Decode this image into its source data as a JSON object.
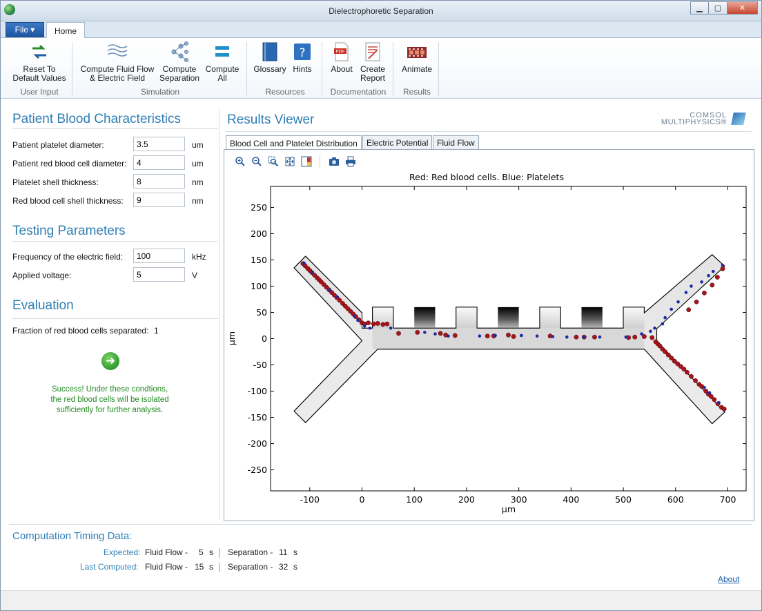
{
  "window": {
    "title": "Dielectrophoretic Separation",
    "controls": {
      "minimize": "▁",
      "maximize": "▢",
      "close": "✕"
    }
  },
  "ribbon": {
    "tabs": {
      "file": "File ▾",
      "home": "Home"
    },
    "buttons": {
      "reset": [
        "Reset To",
        "Default Values"
      ],
      "compute_flow": [
        "Compute Fluid Flow",
        "& Electric Field"
      ],
      "compute_separation": [
        "Compute",
        "Separation"
      ],
      "compute_all": [
        "Compute",
        "All"
      ],
      "glossary": "Glossary",
      "hints": "Hints",
      "about": "About",
      "create_report": [
        "Create",
        "Report"
      ],
      "animate": "Animate"
    },
    "groups": {
      "user_input": "User Input",
      "simulation": "Simulation",
      "resources": "Resources",
      "documentation": "Documentation",
      "results": "Results"
    }
  },
  "patient": {
    "title": "Patient Blood Characteristics",
    "fields": [
      {
        "label": "Patient platelet diameter:",
        "value": "3.5",
        "unit": "um"
      },
      {
        "label": "Patient red blood cell diameter:",
        "value": "4",
        "unit": "um"
      },
      {
        "label": "Platelet shell thickness:",
        "value": "8",
        "unit": "nm"
      },
      {
        "label": "Red blood cell shell thickness:",
        "value": "9",
        "unit": "nm"
      }
    ]
  },
  "testing": {
    "title": "Testing Parameters",
    "fields": [
      {
        "label": "Frequency of the electric field:",
        "value": "100",
        "unit": "kHz"
      },
      {
        "label": "Applied voltage:",
        "value": "5",
        "unit": "V"
      }
    ]
  },
  "evaluation": {
    "title": "Evaluation",
    "fraction_label": "Fraction of red blood cells separated:",
    "fraction_value": "1",
    "success_lines": [
      "Success! Under these condtions,",
      "the red blood cells will be isolated",
      "sufficiently for further analysis."
    ]
  },
  "results": {
    "title": "Results Viewer",
    "logo": {
      "line1": "COMSOL",
      "line2": "MULTIPHYSICS®"
    },
    "tabs": [
      "Blood Cell and Platelet Distribution",
      "Electric Potential",
      "Fluid Flow"
    ],
    "toolbar_icons": [
      "zoom-in-icon",
      "zoom-out-icon",
      "zoom-box-icon",
      "zoom-extents-icon",
      "color-table-icon",
      "camera-icon",
      "print-icon"
    ]
  },
  "chart_data": {
    "type": "scatter",
    "title": "Red: Red blood cells. Blue: Platelets",
    "xlabel": "µm",
    "ylabel": "µm",
    "xlim": [
      -175,
      735
    ],
    "ylim": [
      -290,
      290
    ],
    "xticks": [
      -100,
      0,
      100,
      200,
      300,
      400,
      500,
      600,
      700
    ],
    "yticks": [
      -250,
      -200,
      -150,
      -100,
      -50,
      0,
      50,
      100,
      150,
      200,
      250
    ],
    "colors": {
      "red": "#a8141c",
      "blue": "#1c2aa5"
    },
    "series": [
      {
        "color": "red",
        "points": [
          [
            -113,
            143
          ],
          [
            -109,
            139
          ],
          [
            -104,
            134
          ],
          [
            -100,
            130
          ],
          [
            -96,
            126
          ],
          [
            -91,
            121
          ],
          [
            -86,
            116
          ],
          [
            -82,
            112
          ],
          [
            -78,
            108
          ],
          [
            -73,
            103
          ],
          [
            -68,
            98
          ],
          [
            -63,
            93
          ],
          [
            -58,
            88
          ],
          [
            -53,
            83
          ],
          [
            -48,
            78
          ],
          [
            -43,
            73
          ],
          [
            -37,
            67
          ],
          [
            -32,
            62
          ],
          [
            -27,
            57
          ],
          [
            -22,
            52
          ],
          [
            -17,
            47
          ],
          [
            -12,
            42
          ],
          [
            -6,
            36
          ],
          [
            0,
            30
          ],
          [
            5,
            28
          ],
          [
            12,
            30
          ],
          [
            22,
            28
          ],
          [
            30,
            29
          ],
          [
            40,
            27
          ],
          [
            48,
            28
          ],
          [
            70,
            10
          ],
          [
            106,
            12
          ],
          [
            150,
            10
          ],
          [
            160,
            7
          ],
          [
            178,
            6
          ],
          [
            240,
            5
          ],
          [
            252,
            5
          ],
          [
            280,
            7
          ],
          [
            290,
            4
          ],
          [
            360,
            5
          ],
          [
            410,
            3
          ],
          [
            425,
            3
          ],
          [
            445,
            3
          ],
          [
            510,
            2
          ],
          [
            522,
            3
          ],
          [
            540,
            4
          ],
          [
            555,
            2
          ],
          [
            562,
            -6
          ],
          [
            566,
            -10
          ],
          [
            570,
            -14
          ],
          [
            575,
            -20
          ],
          [
            580,
            -25
          ],
          [
            586,
            -31
          ],
          [
            592,
            -37
          ],
          [
            598,
            -43
          ],
          [
            604,
            -48
          ],
          [
            610,
            -53
          ],
          [
            616,
            -58
          ],
          [
            622,
            -64
          ],
          [
            630,
            -72
          ],
          [
            638,
            -80
          ],
          [
            645,
            -87
          ],
          [
            650,
            -91
          ],
          [
            658,
            -100
          ],
          [
            663,
            -106
          ],
          [
            668,
            -110
          ],
          [
            674,
            -116
          ],
          [
            681,
            -124
          ],
          [
            688,
            -131
          ],
          [
            693,
            -134
          ],
          [
            625,
            55
          ],
          [
            640,
            70
          ],
          [
            655,
            87
          ],
          [
            670,
            102
          ],
          [
            680,
            117
          ],
          [
            690,
            133
          ]
        ]
      },
      {
        "color": "blue",
        "points": [
          [
            -111,
            144
          ],
          [
            -95,
            126
          ],
          [
            -62,
            92
          ],
          [
            -48,
            80
          ],
          [
            -15,
            43
          ],
          [
            -8,
            35
          ],
          [
            5,
            24
          ],
          [
            15,
            20
          ],
          [
            55,
            20
          ],
          [
            120,
            12
          ],
          [
            140,
            9
          ],
          [
            165,
            5
          ],
          [
            225,
            5
          ],
          [
            255,
            6
          ],
          [
            305,
            6
          ],
          [
            335,
            5
          ],
          [
            365,
            4
          ],
          [
            392,
            3
          ],
          [
            425,
            3
          ],
          [
            455,
            3
          ],
          [
            505,
            3
          ],
          [
            535,
            9
          ],
          [
            552,
            14
          ],
          [
            560,
            20
          ],
          [
            575,
            28
          ],
          [
            580,
            40
          ],
          [
            592,
            56
          ],
          [
            605,
            70
          ],
          [
            620,
            88
          ],
          [
            630,
            100
          ],
          [
            650,
            108
          ],
          [
            663,
            120
          ],
          [
            672,
            128
          ],
          [
            690,
            140
          ],
          [
            655,
            -93
          ],
          [
            665,
            -103
          ],
          [
            683,
            -122
          ]
        ]
      }
    ],
    "grid": false
  },
  "footer": {
    "title": "Computation Timing Data:",
    "expected": {
      "label": "Expected:",
      "flow_label": "Fluid Flow -",
      "flow_value": "5",
      "sep_label": "Separation -",
      "sep_value": "11",
      "unit": "s"
    },
    "last": {
      "label": "Last Computed:",
      "flow_label": "Fluid Flow -",
      "flow_value": "15",
      "sep_label": "Separation -",
      "sep_value": "32",
      "unit": "s"
    },
    "about_link": "About"
  }
}
